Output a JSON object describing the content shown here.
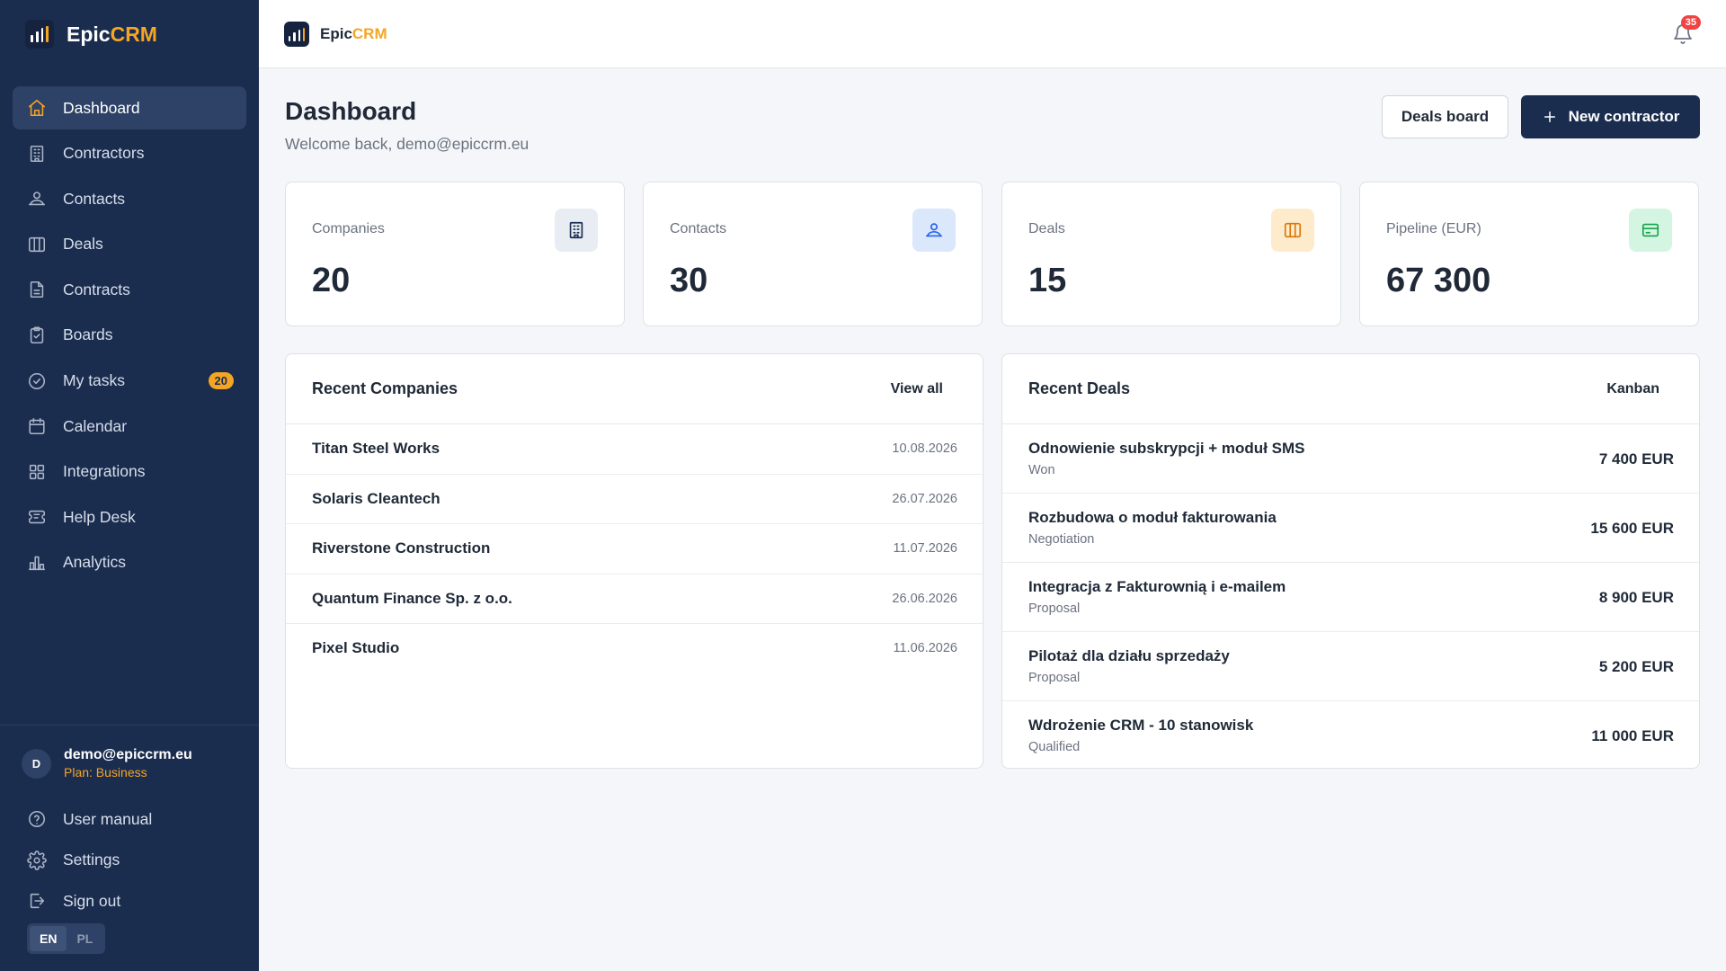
{
  "brand": {
    "name_part1": "Epic",
    "name_part2": "CRM"
  },
  "sidebar": {
    "items": [
      {
        "label": "Dashboard",
        "icon": "home-icon",
        "active": true
      },
      {
        "label": "Contractors",
        "icon": "building-icon"
      },
      {
        "label": "Contacts",
        "icon": "contacts-icon"
      },
      {
        "label": "Deals",
        "icon": "columns-icon"
      },
      {
        "label": "Contracts",
        "icon": "document-icon"
      },
      {
        "label": "Boards",
        "icon": "clipboard-icon"
      },
      {
        "label": "My tasks",
        "icon": "check-circle-icon",
        "badge": "20"
      },
      {
        "label": "Calendar",
        "icon": "calendar-icon"
      },
      {
        "label": "Integrations",
        "icon": "grid-icon"
      },
      {
        "label": "Help Desk",
        "icon": "ticket-icon"
      },
      {
        "label": "Analytics",
        "icon": "bar-chart-icon"
      }
    ],
    "user": {
      "initial": "D",
      "email": "demo@epiccrm.eu",
      "plan": "Plan: Business"
    },
    "bottom_links": [
      {
        "label": "User manual",
        "icon": "help-circle-icon"
      },
      {
        "label": "Settings",
        "icon": "gear-icon"
      },
      {
        "label": "Sign out",
        "icon": "sign-out-icon"
      }
    ],
    "languages": [
      "EN",
      "PL"
    ],
    "active_language": "EN"
  },
  "topbar": {
    "notification_count": "35"
  },
  "header": {
    "title": "Dashboard",
    "subtitle": "Welcome back, demo@epiccrm.eu",
    "deals_board_label": "Deals board",
    "new_contractor_label": "New contractor"
  },
  "stats": [
    {
      "label": "Companies",
      "value": "20",
      "icon": "building-icon",
      "icon_bg": "#e8edf4",
      "icon_color": "#1b2d4f"
    },
    {
      "label": "Contacts",
      "value": "30",
      "icon": "contacts-icon",
      "icon_bg": "#dbe7fb",
      "icon_color": "#2563eb"
    },
    {
      "label": "Deals",
      "value": "15",
      "icon": "columns-icon",
      "icon_bg": "#fdebcc",
      "icon_color": "#d97706"
    },
    {
      "label": "Pipeline (EUR)",
      "value": "67 300",
      "icon": "credit-card-icon",
      "icon_bg": "#d5f5e3",
      "icon_color": "#16a34a"
    }
  ],
  "recent_companies": {
    "title": "Recent Companies",
    "link": "View all",
    "rows": [
      {
        "name": "Titan Steel Works",
        "date": "10.08.2026"
      },
      {
        "name": "Solaris Cleantech",
        "date": "26.07.2026"
      },
      {
        "name": "Riverstone Construction",
        "date": "11.07.2026"
      },
      {
        "name": "Quantum Finance Sp. z o.o.",
        "date": "26.06.2026"
      },
      {
        "name": "Pixel Studio",
        "date": "11.06.2026"
      }
    ]
  },
  "recent_deals": {
    "title": "Recent Deals",
    "link": "Kanban",
    "rows": [
      {
        "name": "Odnowienie subskrypcji + moduł SMS",
        "stage": "Won",
        "amount": "7 400 EUR"
      },
      {
        "name": "Rozbudowa o moduł fakturowania",
        "stage": "Negotiation",
        "amount": "15 600 EUR"
      },
      {
        "name": "Integracja z Fakturownią i e-mailem",
        "stage": "Proposal",
        "amount": "8 900 EUR"
      },
      {
        "name": "Pilotaż dla działu sprzedaży",
        "stage": "Proposal",
        "amount": "5 200 EUR"
      },
      {
        "name": "Wdrożenie CRM - 10 stanowisk",
        "stage": "Qualified",
        "amount": "11 000 EUR"
      }
    ]
  },
  "colors": {
    "sidebar_bg": "#1b2d4f",
    "accent": "#f5a524",
    "notification": "#ef4444"
  }
}
